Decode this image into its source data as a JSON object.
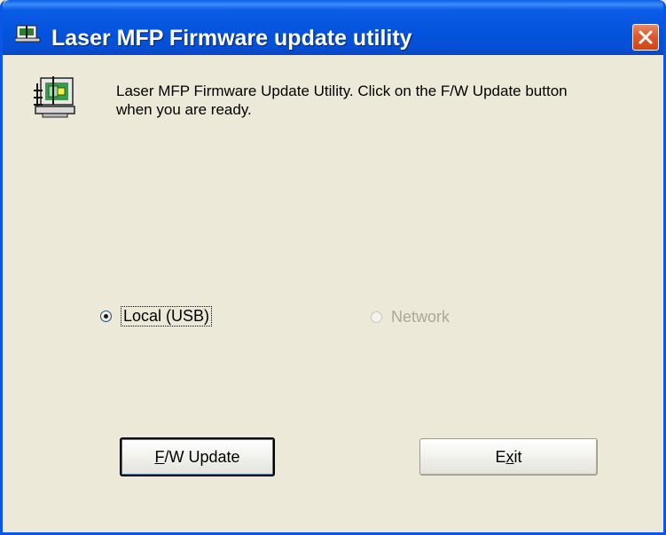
{
  "window": {
    "title": "Laser MFP Firmware update utility",
    "close_icon": "close-icon"
  },
  "message": "Laser MFP Firmware Update Utility. Click on the F/W Update button when you are ready.",
  "connection": {
    "options": [
      {
        "label": "Local (USB)",
        "selected": true,
        "enabled": true
      },
      {
        "label": "Network",
        "selected": false,
        "enabled": false
      }
    ]
  },
  "buttons": {
    "update_prefix": "",
    "update_mnemonic": "F",
    "update_rest": "/W Update",
    "exit_prefix": "E",
    "exit_mnemonic": "x",
    "exit_rest": "it"
  },
  "colors": {
    "titlebar": "#0453dc",
    "face": "#ece9d8",
    "close": "#e0582c",
    "disabled_text": "#aca899"
  }
}
